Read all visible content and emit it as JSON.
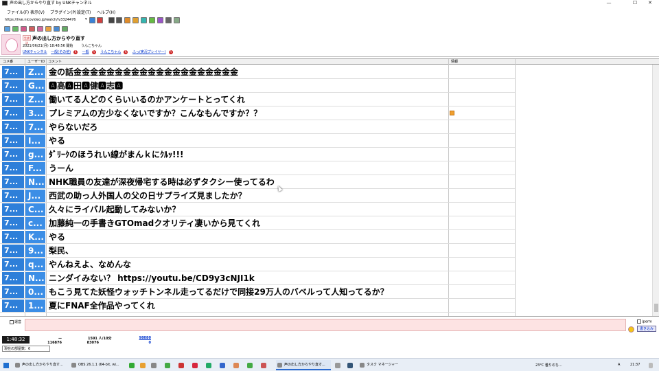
{
  "window": {
    "title": "声の出し方からやり直す by UNKチャンネル",
    "controls": [
      "—",
      "☐",
      "✕"
    ]
  },
  "menu": [
    "ファイル(F)",
    "表示(V)",
    "プラグイン(P)",
    "設定(T)",
    "ヘルプ(H)"
  ],
  "url": "https://live.nicovideo.jp/watch/lv3324476",
  "broadcast": {
    "live_tag": "生放送",
    "title": "声の出し方からやり直す",
    "date": "2021/06/21(月) 18:48:56 開始",
    "user": "うんこちゃん",
    "links": [
      "UNKチャンネル",
      "一般(その他)",
      "一般",
      "うんこちゃん",
      "ふっ(実況プレイヤー)"
    ],
    "link_icon": "R"
  },
  "grid": {
    "headers": {
      "no": "コメ番",
      "user": "ユーザーID",
      "comment": "コメント",
      "info": "情報"
    },
    "rows": [
      {
        "no": "7...",
        "uid": "Z...",
        "text": "金の話金金金金金金金金金金金金金金金金金金金金",
        "info": false
      },
      {
        "no": "7...",
        "uid": "G...",
        "text": "🅰高🅰田🅰健🅰志🅰",
        "info": false
      },
      {
        "no": "7...",
        "uid": "Z...",
        "text": "働いてる人どのくらいいるのかアンケートとってくれ",
        "info": false
      },
      {
        "no": "7...",
        "uid": "3...",
        "text": "プレミアムの方少なくないですか？こんなもんですか？？",
        "info": true
      },
      {
        "no": "7...",
        "uid": "7...",
        "text": "やらないだろ",
        "info": false
      },
      {
        "no": "7...",
        "uid": "I...",
        "text": "やる",
        "info": false
      },
      {
        "no": "7...",
        "uid": "g...",
        "text": "ﾀﾞﾘｰｸのほうれい線がまんｋにｸﾙｯ!!!",
        "info": false
      },
      {
        "no": "7...",
        "uid": "F...",
        "text": "うーん",
        "info": false
      },
      {
        "no": "7...",
        "uid": "N...",
        "text": "NHK職員の友達が深夜帰宅する時は必ずタクシー使ってるわ",
        "info": false
      },
      {
        "no": "7...",
        "uid": "J...",
        "text": "西武の助っ人外国人の父の日サプライズ見ましたか？",
        "info": false
      },
      {
        "no": "7...",
        "uid": "C...",
        "text": "久々にライバル起動してみないか？",
        "info": false
      },
      {
        "no": "7...",
        "uid": "c...",
        "text": "加藤純一の手書きGTOmadクオリティ凄いから見てくれ",
        "info": false
      },
      {
        "no": "7...",
        "uid": "K...",
        "text": "やる",
        "info": false
      },
      {
        "no": "7...",
        "uid": "9...",
        "text": "梨民、",
        "info": false
      },
      {
        "no": "7...",
        "uid": "q...",
        "text": "やんねえよ、なめんな",
        "info": false
      },
      {
        "no": "7...",
        "uid": "N...",
        "text": "ニンダイみない？ https://youtu.be/CD9y3cNJI1k",
        "info": false
      },
      {
        "no": "7...",
        "uid": "0...",
        "text": "もこう見てた妖怪ウォッチトンネル走ってるだけで同接29万人のバベルって人知ってるか？",
        "info": false
      },
      {
        "no": "7...",
        "uid": "1...",
        "text": "夏にFNAF全作品やってくれ",
        "info": false
      }
    ]
  },
  "input": {
    "manual_label": "運営",
    "perm_label": "/perm",
    "submit_label": "書き込み"
  },
  "status": {
    "timer": "1:48:32",
    "comments": "116876",
    "viewers_rate": "1591 人/10分",
    "viewers": "83076",
    "points": "98080",
    "points_sub": "0",
    "dash": "—",
    "generation_label": "現在の部屋数：6"
  },
  "taskbar": {
    "tasks": [
      "声の出し方からやり直す...",
      "OBS 26.1.1 (64-bit, wi...",
      "声の出し方からやり直す...",
      "タスク マネージャー"
    ],
    "weather": "23°C 曇りのち...",
    "time": "21:37",
    "ime": "A"
  },
  "colors": {
    "row_number": "#2e7fd9",
    "row_userid": "#3c8ee6",
    "input_bg": "#fde3e3"
  }
}
